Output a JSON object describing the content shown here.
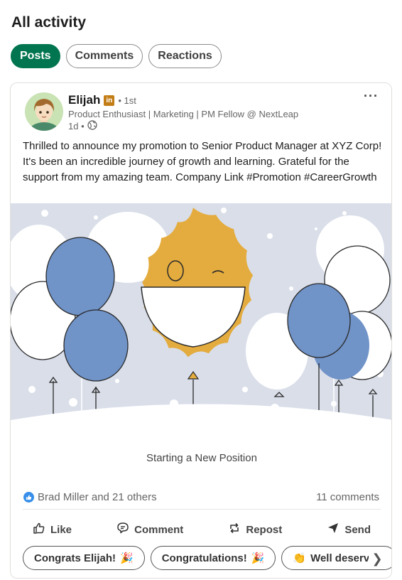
{
  "page": {
    "title": "All activity"
  },
  "filters": [
    {
      "label": "Posts",
      "active": true
    },
    {
      "label": "Comments",
      "active": false
    },
    {
      "label": "Reactions",
      "active": false
    }
  ],
  "post": {
    "author": {
      "name": "Elijah",
      "badge": "in",
      "degree": "• 1st",
      "headline": "Product Enthusiast | Marketing | PM Fellow @ NextLeap",
      "time": "1d •"
    },
    "text": "Thrilled to announce my promotion to Senior Product Manager at XYZ Corp! It's been an incredible journey of growth and learning. Grateful for the support from my amazing team. Company Link #Promotion #CareerGrowth",
    "media_caption": "Starting a New Position",
    "reactions_text": "Brad Miller and 21 others",
    "comments_text": "11 comments"
  },
  "actions": {
    "like": "Like",
    "comment": "Comment",
    "repost": "Repost",
    "send": "Send"
  },
  "suggestions": [
    {
      "text": "Congrats Elijah!",
      "emoji": "🎉",
      "emoji_first": false
    },
    {
      "text": "Congratulations!",
      "emoji": "🎉",
      "emoji_first": false
    },
    {
      "text": "Well deserved,",
      "emoji": "👏",
      "emoji_first": true
    }
  ],
  "colors": {
    "accent": "#01754f",
    "sun": "#e4ac3e",
    "balloon_blue": "#7093c8",
    "sky": "#d9dee9",
    "like_blue": "#378fe9",
    "badge": "#c37d16"
  }
}
